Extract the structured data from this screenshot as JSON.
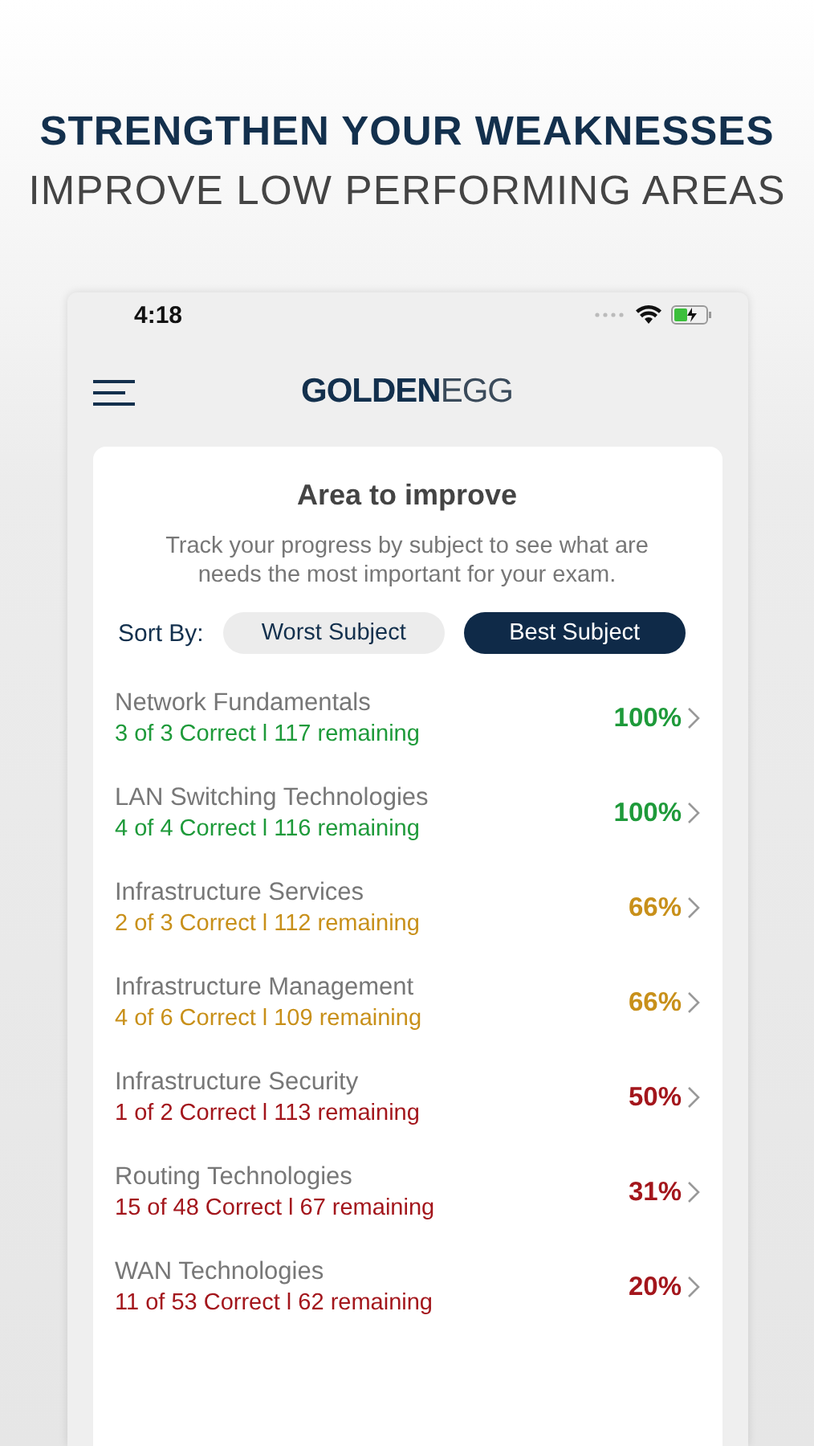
{
  "headline": "STRENGTHEN YOUR WEAKNESSES",
  "subheadline": "IMPROVE LOW PERFORMING AREAS",
  "status_bar": {
    "time": "4:18"
  },
  "logo": {
    "bold": "GOLDEN",
    "light": "EGG"
  },
  "card": {
    "title": "Area to improve",
    "description": "Track your progress by subject to see what are needs the most important for your exam."
  },
  "sort": {
    "label": "Sort By:",
    "options": [
      {
        "label": "Worst Subject",
        "selected": false
      },
      {
        "label": "Best Subject",
        "selected": true
      }
    ]
  },
  "subjects": [
    {
      "name": "Network Fundamentals",
      "detail": "3 of 3 Correct l 117 remaining",
      "percent": "100%",
      "color": "#1e9a3a"
    },
    {
      "name": "LAN Switching Technologies",
      "detail": "4 of 4 Correct l 116 remaining",
      "percent": "100%",
      "color": "#1e9a3a"
    },
    {
      "name": "Infrastructure Services",
      "detail": "2 of 3 Correct l 112 remaining",
      "percent": "66%",
      "color": "#c8901a"
    },
    {
      "name": "Infrastructure Management",
      "detail": "4 of 6 Correct l 109 remaining",
      "percent": "66%",
      "color": "#c8901a"
    },
    {
      "name": "Infrastructure Security",
      "detail": "1 of 2 Correct l 113 remaining",
      "percent": "50%",
      "color": "#a3161c"
    },
    {
      "name": "Routing Technologies",
      "detail": "15 of 48 Correct l 67 remaining",
      "percent": "31%",
      "color": "#a3161c"
    },
    {
      "name": "WAN Technologies",
      "detail": "11 of 53 Correct l 62 remaining",
      "percent": "20%",
      "color": "#a3161c"
    }
  ]
}
